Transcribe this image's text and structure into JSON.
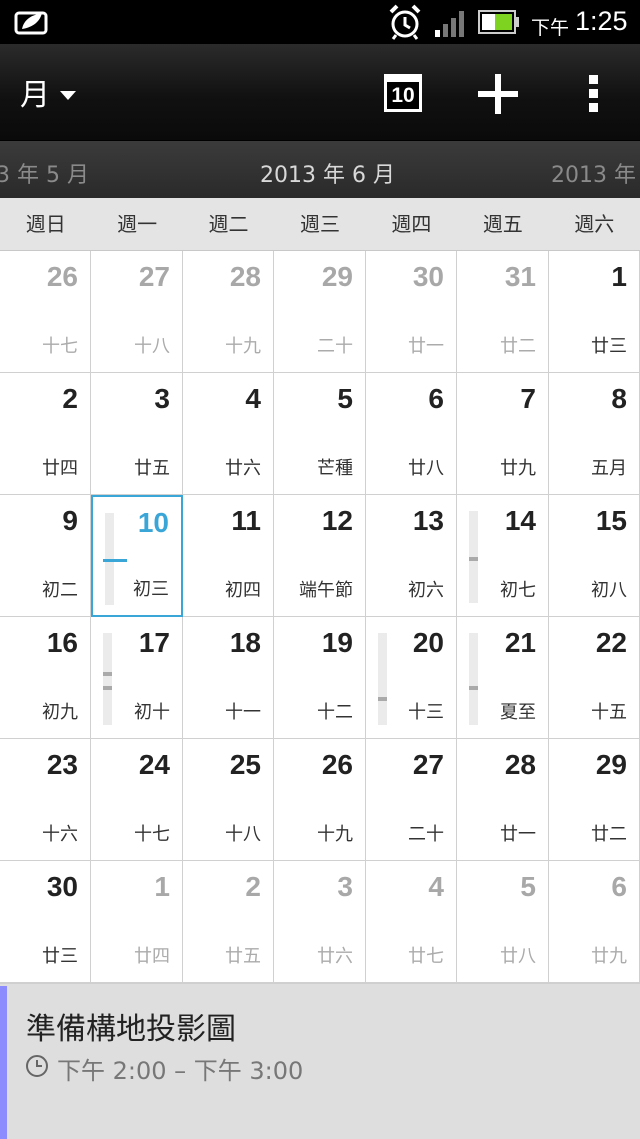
{
  "status_bar": {
    "notification_icon": "sense-leaf-icon",
    "alarm_icon": "alarm-clock-icon",
    "signal_icon": "signal-bars-icon",
    "battery_icon": "battery-icon",
    "ampm": "下午",
    "time": "1:25"
  },
  "action_bar": {
    "view_label": "月",
    "today_day": "10",
    "add_icon": "plus-icon",
    "more_icon": "overflow-menu-icon"
  },
  "months": {
    "prev": "3 年 5 月",
    "current": "2013 年 6 月",
    "next": "2013 年 7"
  },
  "weekdays": [
    "週日",
    "週一",
    "週二",
    "週三",
    "週四",
    "週五",
    "週六"
  ],
  "weeks": [
    [
      {
        "day": "26",
        "lunar": "十七",
        "other": true
      },
      {
        "day": "27",
        "lunar": "十八",
        "other": true
      },
      {
        "day": "28",
        "lunar": "十九",
        "other": true
      },
      {
        "day": "29",
        "lunar": "二十",
        "other": true
      },
      {
        "day": "30",
        "lunar": "廿一",
        "other": true
      },
      {
        "day": "31",
        "lunar": "廿二",
        "other": true
      },
      {
        "day": "1",
        "lunar": "廿三",
        "other": false
      }
    ],
    [
      {
        "day": "2",
        "lunar": "廿四",
        "other": false
      },
      {
        "day": "3",
        "lunar": "廿五",
        "other": false
      },
      {
        "day": "4",
        "lunar": "廿六",
        "other": false
      },
      {
        "day": "5",
        "lunar": "芒種",
        "other": false
      },
      {
        "day": "6",
        "lunar": "廿八",
        "other": false
      },
      {
        "day": "7",
        "lunar": "廿九",
        "other": false
      },
      {
        "day": "8",
        "lunar": "五月",
        "other": false
      }
    ],
    [
      {
        "day": "9",
        "lunar": "初二",
        "other": false
      },
      {
        "day": "10",
        "lunar": "初三",
        "other": false,
        "today": true,
        "events": [
          0.5
        ]
      },
      {
        "day": "11",
        "lunar": "初四",
        "other": false
      },
      {
        "day": "12",
        "lunar": "端午節",
        "other": false
      },
      {
        "day": "13",
        "lunar": "初六",
        "other": false
      },
      {
        "day": "14",
        "lunar": "初七",
        "other": false,
        "events": [
          0.5
        ]
      },
      {
        "day": "15",
        "lunar": "初八",
        "other": false
      }
    ],
    [
      {
        "day": "16",
        "lunar": "初九",
        "other": false
      },
      {
        "day": "17",
        "lunar": "初十",
        "other": false,
        "events": [
          0.42,
          0.58
        ]
      },
      {
        "day": "18",
        "lunar": "十一",
        "other": false
      },
      {
        "day": "19",
        "lunar": "十二",
        "other": false
      },
      {
        "day": "20",
        "lunar": "十三",
        "other": false,
        "events": [
          0.7
        ]
      },
      {
        "day": "21",
        "lunar": "夏至",
        "other": false,
        "events": [
          0.58
        ]
      },
      {
        "day": "22",
        "lunar": "十五",
        "other": false
      }
    ],
    [
      {
        "day": "23",
        "lunar": "十六",
        "other": false
      },
      {
        "day": "24",
        "lunar": "十七",
        "other": false
      },
      {
        "day": "25",
        "lunar": "十八",
        "other": false
      },
      {
        "day": "26",
        "lunar": "十九",
        "other": false
      },
      {
        "day": "27",
        "lunar": "二十",
        "other": false
      },
      {
        "day": "28",
        "lunar": "廿一",
        "other": false
      },
      {
        "day": "29",
        "lunar": "廿二",
        "other": false
      }
    ],
    [
      {
        "day": "30",
        "lunar": "廿三",
        "other": false
      },
      {
        "day": "1",
        "lunar": "廿四",
        "other": true
      },
      {
        "day": "2",
        "lunar": "廿五",
        "other": true
      },
      {
        "day": "3",
        "lunar": "廿六",
        "other": true
      },
      {
        "day": "4",
        "lunar": "廿七",
        "other": true
      },
      {
        "day": "5",
        "lunar": "廿八",
        "other": true
      },
      {
        "day": "6",
        "lunar": "廿九",
        "other": true
      }
    ]
  ],
  "agenda": {
    "event_color": "#8c8cff",
    "title": "準備構地投影圖",
    "clock_icon": "clock-icon",
    "time": "下午 2:00 – 下午 3:00"
  },
  "colors": {
    "today_accent": "#3aa6d8"
  }
}
